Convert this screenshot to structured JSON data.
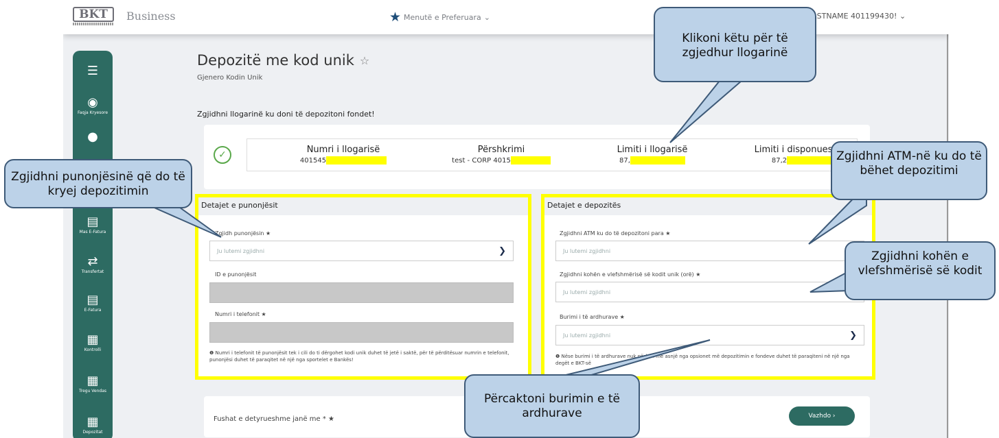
{
  "header": {
    "logo_text": "BKT",
    "app_name": "Business",
    "favorites_menu": "Menutë e Preferuara",
    "user_name": "RSTNAME 401199430!"
  },
  "sidebar": {
    "items": [
      {
        "icon": "menu-icon",
        "label": ""
      },
      {
        "icon": "compass-icon",
        "label": "Faqja Kryesore"
      },
      {
        "icon": "document-icon",
        "label": ""
      },
      {
        "icon": "invoice-icon",
        "label": "Mas E-Fatura"
      },
      {
        "icon": "transfer-icon",
        "label": "Transfertat"
      },
      {
        "icon": "invoice-icon",
        "label": "E-Fatura"
      },
      {
        "icon": "control-icon",
        "label": "Kontrolli"
      },
      {
        "icon": "trade-icon",
        "label": "Tregu Vendas"
      },
      {
        "icon": "deposit-icon",
        "label": "Depozitat"
      }
    ]
  },
  "page": {
    "title": "Depozitë me kod unik",
    "subtitle": "Gjenero Kodin Unik",
    "section_title": "Zgjidhni llogarinë ku doni të depozitoni fondet!"
  },
  "account": {
    "columns": [
      {
        "header": "Numri i llogarisë",
        "value": "401545"
      },
      {
        "header": "Përshkrimi",
        "value": "test - CORP 4015"
      },
      {
        "header": "Limiti i llogarisë",
        "value": "87,"
      },
      {
        "header": "Limiti i disponueshëm",
        "value": "87,2"
      }
    ]
  },
  "employee_panel": {
    "title": "Detajet e punonjësit",
    "select_label": "Zgjidh punonjësin ★",
    "select_placeholder": "Ju lutemi zgjidhni",
    "id_label": "ID e punonjësit",
    "phone_label": "Numri i telefonit ★",
    "note": "Numri i telefonit të punonjësit tek i cili do ti dërgohet kodi unik duhet të jetë i saktë, për të përditësuar numrin e telefonit, punonjësi duhet të paraqitet në një nga sportelet e Bankës!"
  },
  "deposit_panel": {
    "title": "Detajet e depozitës",
    "atm_label": "Zgjidhni ATM ku do të depozitoni para ★",
    "atm_placeholder": "Ju lutemi zgjidhni",
    "validity_label": "Zgjidhni kohën e vlefshmërisë së kodit unik (orë) ★",
    "validity_placeholder": "Ju lutemi zgjidhni",
    "source_label": "Burimi i të ardhurave ★",
    "source_placeholder": "Ju lutemi zgjidhni",
    "note": "Nëse burimi i të ardhurave nuk përkon me asnjë nga opsionet më          depozitimin e fondeve duhet të paraqiteni në një nga degët e BKT-së"
  },
  "footer": {
    "required_text": "Fushat e detyrueshme janë me * ★",
    "next_button": "Vazhdo ›"
  },
  "callouts": {
    "account": "Klikoni këtu për të zgjedhur llogarinë",
    "employee": "Zgjidhni punonjësinë që do të kryej depozitimin",
    "atm": "Zgjidhni ATM-në ku do të bëhet depozitimi",
    "validity": "Zgjidhni kohën e vlefshmërisë së kodit",
    "source": "Përcaktoni burimin e të ardhurave"
  },
  "colors": {
    "brand_green": "#2d6b62",
    "highlight_yellow": "#ffff00",
    "callout_fill": "#bcd2e8",
    "callout_border": "#3e5a78"
  }
}
